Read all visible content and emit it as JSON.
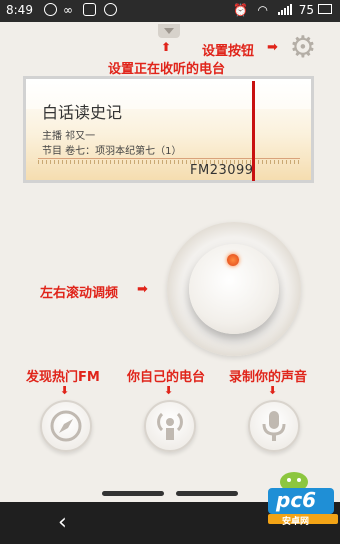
{
  "status_bar": {
    "time": "8:49",
    "battery": "75",
    "icons": [
      "messaging-icon",
      "loop-icon",
      "gallery-icon",
      "check-icon",
      "alarm-icon",
      "wifi-icon",
      "signal-icon",
      "battery-icon"
    ]
  },
  "annotations": {
    "settings_button": "设置按钮",
    "set_station": "设置正在收听的电台",
    "tune_knob": "左右滚动调频",
    "discover_fm": "发现热门FM",
    "my_station": "你自己的电台",
    "record_voice": "录制你的声音"
  },
  "tuner": {
    "station_title": "白话读史记",
    "host": "主播 祁又一",
    "program": "节目 卷七：项羽本纪第七（1）",
    "frequency": "FM23099"
  },
  "bottom_buttons": [
    {
      "name": "discover-button",
      "icon": "compass-icon"
    },
    {
      "name": "my-station-button",
      "icon": "broadcast-icon"
    },
    {
      "name": "record-button",
      "icon": "microphone-icon"
    }
  ],
  "watermark": {
    "logo": "pc6",
    "caption": "安卓网"
  },
  "nav": {
    "back": "‹"
  },
  "colors": {
    "annotation": "#e0241a",
    "needle": "#c81010",
    "background": "#f1eee9"
  }
}
